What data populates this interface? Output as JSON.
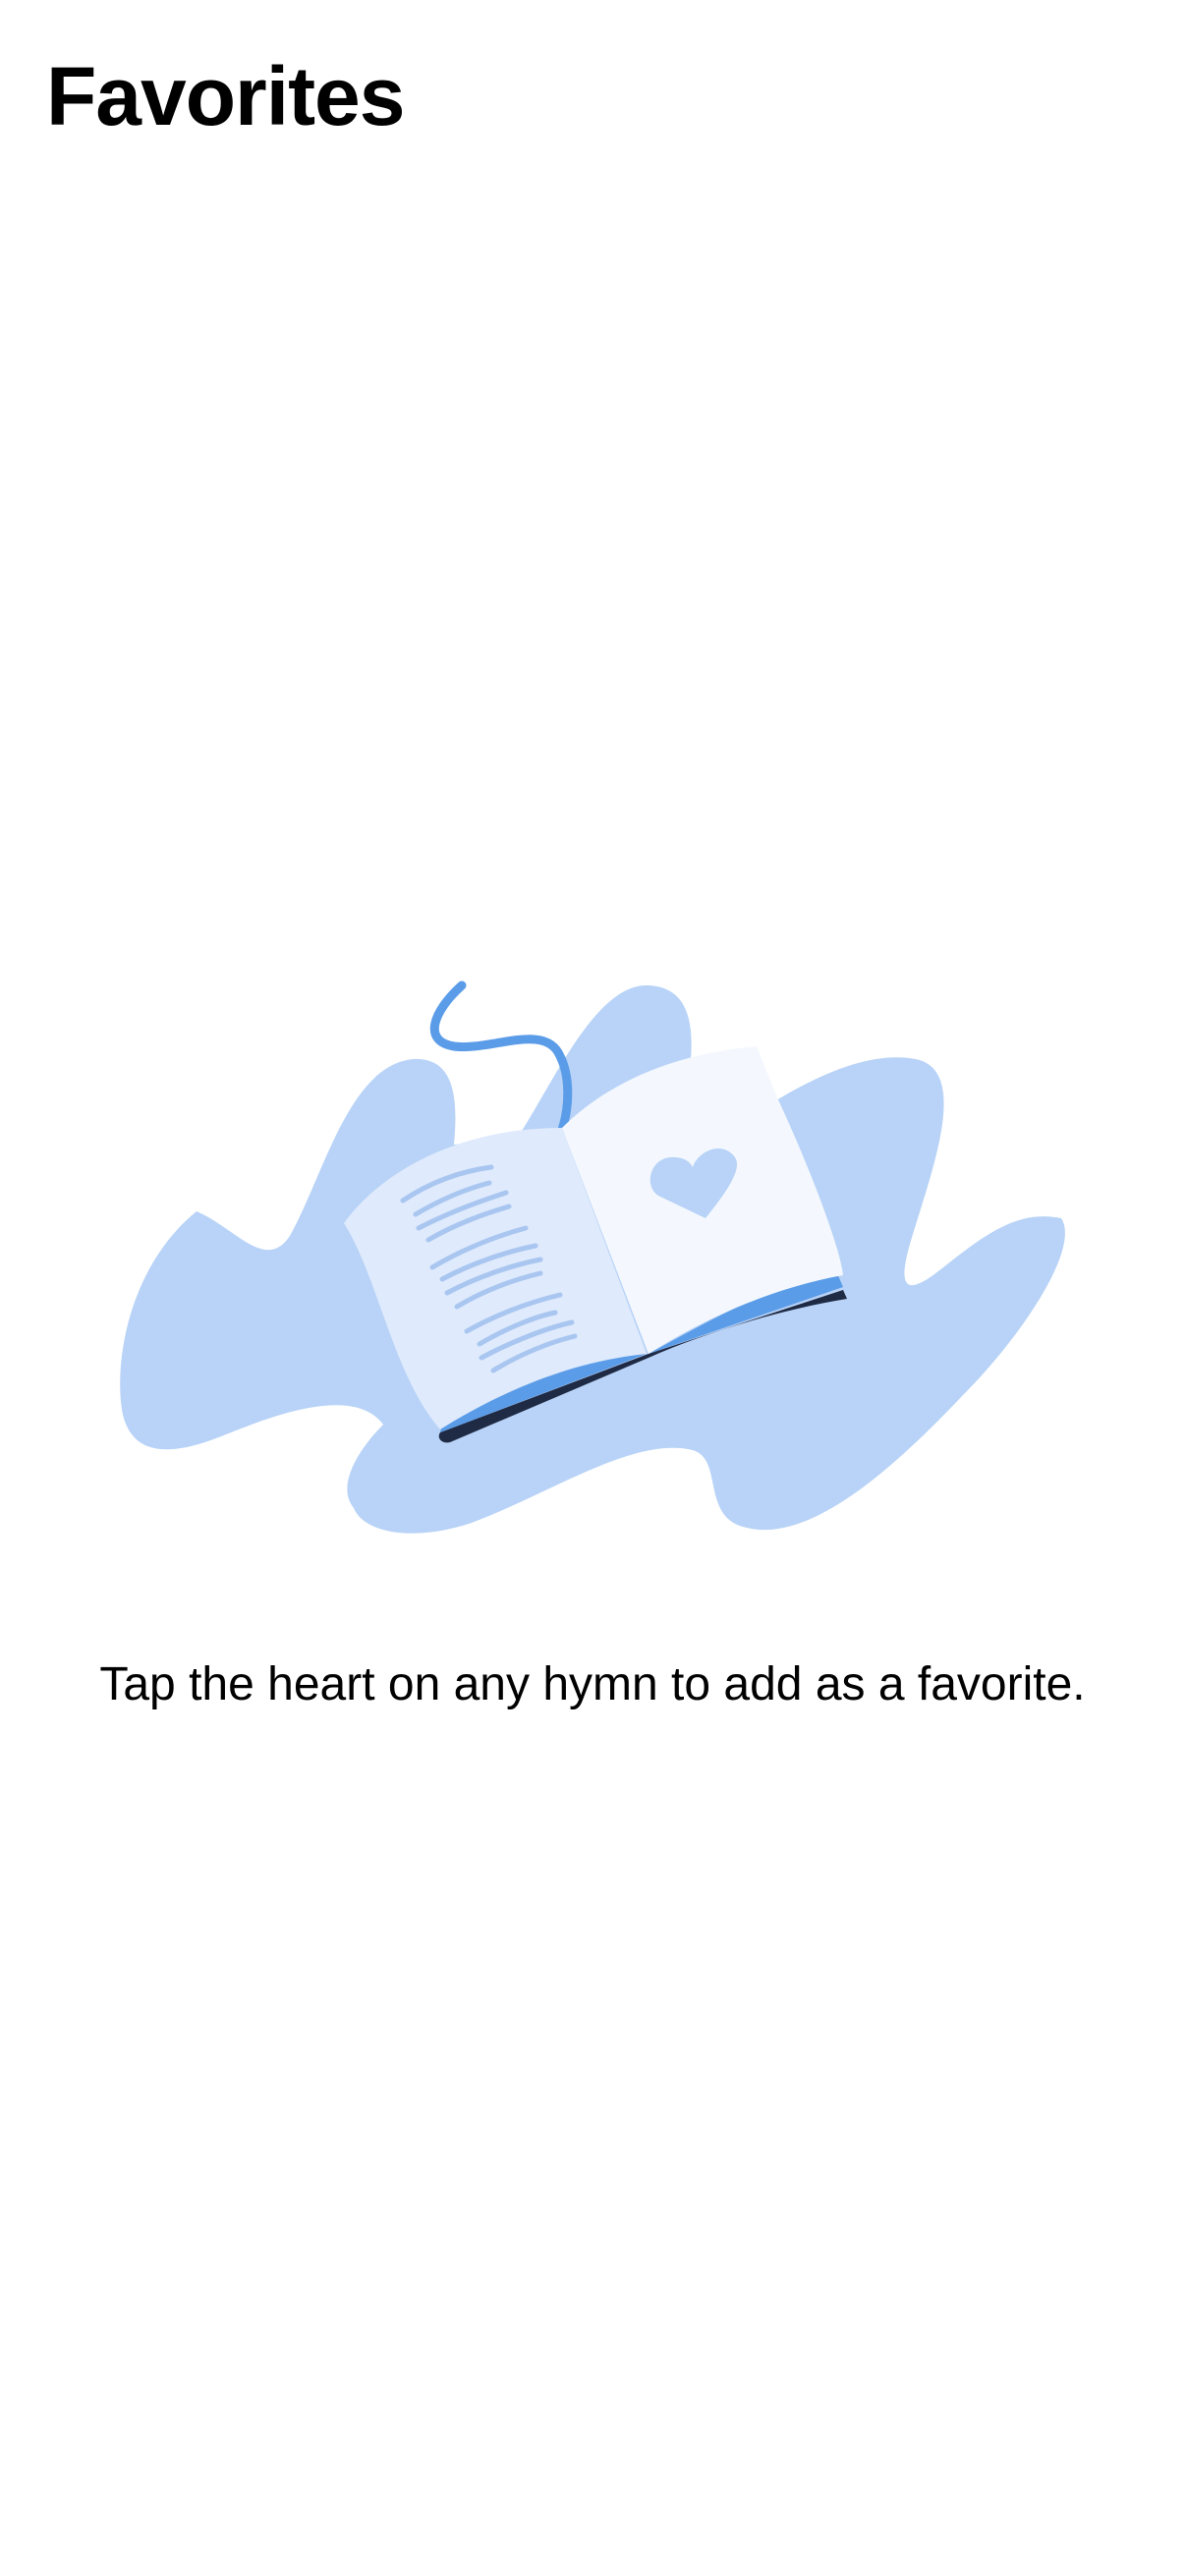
{
  "header": {
    "title": "Favorites"
  },
  "empty_state": {
    "illustration": "open-hymn-book-with-heart",
    "message": "Tap the heart on any hymn to add as a favorite."
  },
  "colors": {
    "blob": "#b8d3f7",
    "page_left": "#dfeafc",
    "page_right": "#f4f8fe",
    "accent_blue": "#5b9ce8",
    "book_cover": "#1f2a44",
    "text_lines": "#a9c6f0"
  }
}
